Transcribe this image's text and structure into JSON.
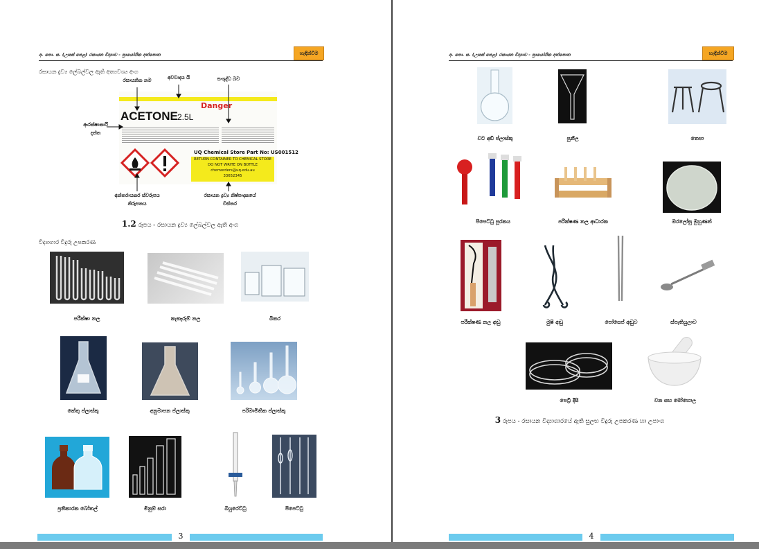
{
  "page_left": {
    "header_title": "අ. පො. ස. (උසස් පෙළ) රසායන විද්‍යාව - ප්‍රායෝගික අත්පොත",
    "header_badge": "හැඳින්වීම",
    "section_label": "රසායන ද්‍රව්‍ය ලේබල්වල ඇති අත්‍යවශ්‍ය අංග",
    "label_sheet": {
      "danger": "Danger",
      "product": "ACETONE",
      "volume": "2.5L",
      "store_part": "UQ Chemical Store Part No: US001512",
      "return_text": "RETURN CONTAINER TO CHEMICAL STORE",
      "do_not_write": "DO NOT WRITE ON BOTTLE",
      "email": "chemorders@uq.edu.au",
      "phone": "33652345"
    },
    "annotations": {
      "chem_name": "රසායනික නම",
      "danger_word": "අවවාදය යි",
      "purity": "සංශුද්ධ බව",
      "precaution": "ආරක්ෂාකාරී",
      "precaution2": "දත්ත",
      "hazard": "අන්තරායකර ස්වරූපය",
      "hazard2": "නිරූපනය",
      "supplier": "රසායන ද්‍රව්‍ය නිෂ්පාදකයේ",
      "supplier2": "විස්තර"
    },
    "figure_caption_num": "1.2",
    "figure_caption_text": "රූපය - රසායන ද්‍රව්‍ය ලේබල්වල ඇති අංග",
    "glassware_label": "විද්‍යාගාර විදුරු උපකරණ",
    "items": {
      "test_tube": "පරීක්ෂා නල",
      "boiling_tube": "කැකෑරුම් නල",
      "beaker": "බීකර",
      "conical_flask": "කේතු ප්ලාස්කු",
      "titration_flask": "අනුමාපන ප්ලාස්කු",
      "volumetric_flask": "පරිමාමිතික ප්ලාස්කු",
      "reagent_bottle": "ප්‍රතිකාරක බෝතල්",
      "measuring_cylinder": "මිනුම් සරා",
      "burette": "බියුරෙට්ටු",
      "pipette": "පිපෙට්ටු"
    },
    "page_number": "3"
  },
  "page_right": {
    "header_title": "අ. පො. ස. (උසස් පෙළ) රසායන විද්‍යාව - ප්‍රායෝගික අත්පොත",
    "header_badge": "හැඳින්වීම",
    "items": {
      "round_flask": "වට අඩි ප්ලාස්කු",
      "funnel": "පුනීල",
      "tripod": "තෙපා",
      "pipette_filler": "පිපෙට්ටු පූරකය",
      "test_tube_rack": "පරීක්ෂණ නල ආධාරක",
      "watch_glass": "ඔරලෝසු මුහුණත්",
      "test_tube_holder": "පරීක්ෂණ නල අඬු",
      "crucible_tongs": "මුෂි අඬු",
      "forceps": "පෝසෙප් අඬුව",
      "spatula": "ස්පැතියුලාව",
      "petri_dish": "පෙට්‍රි දීසි",
      "mortar_pestle": "වන සහ මෝහොල"
    },
    "figure_caption_num": "3",
    "figure_caption_text": "රූපය - රසායන විද්‍යාගාරයේ ඇති සුලභ විදුරු උපකරණ හා උපාංග",
    "page_number": "4"
  },
  "colors": {
    "badge": "#f5a623",
    "page_bar": "#6ccbee",
    "divider": "#444444",
    "label_yellow": "#f4ea1c",
    "danger_red": "#d62323"
  }
}
